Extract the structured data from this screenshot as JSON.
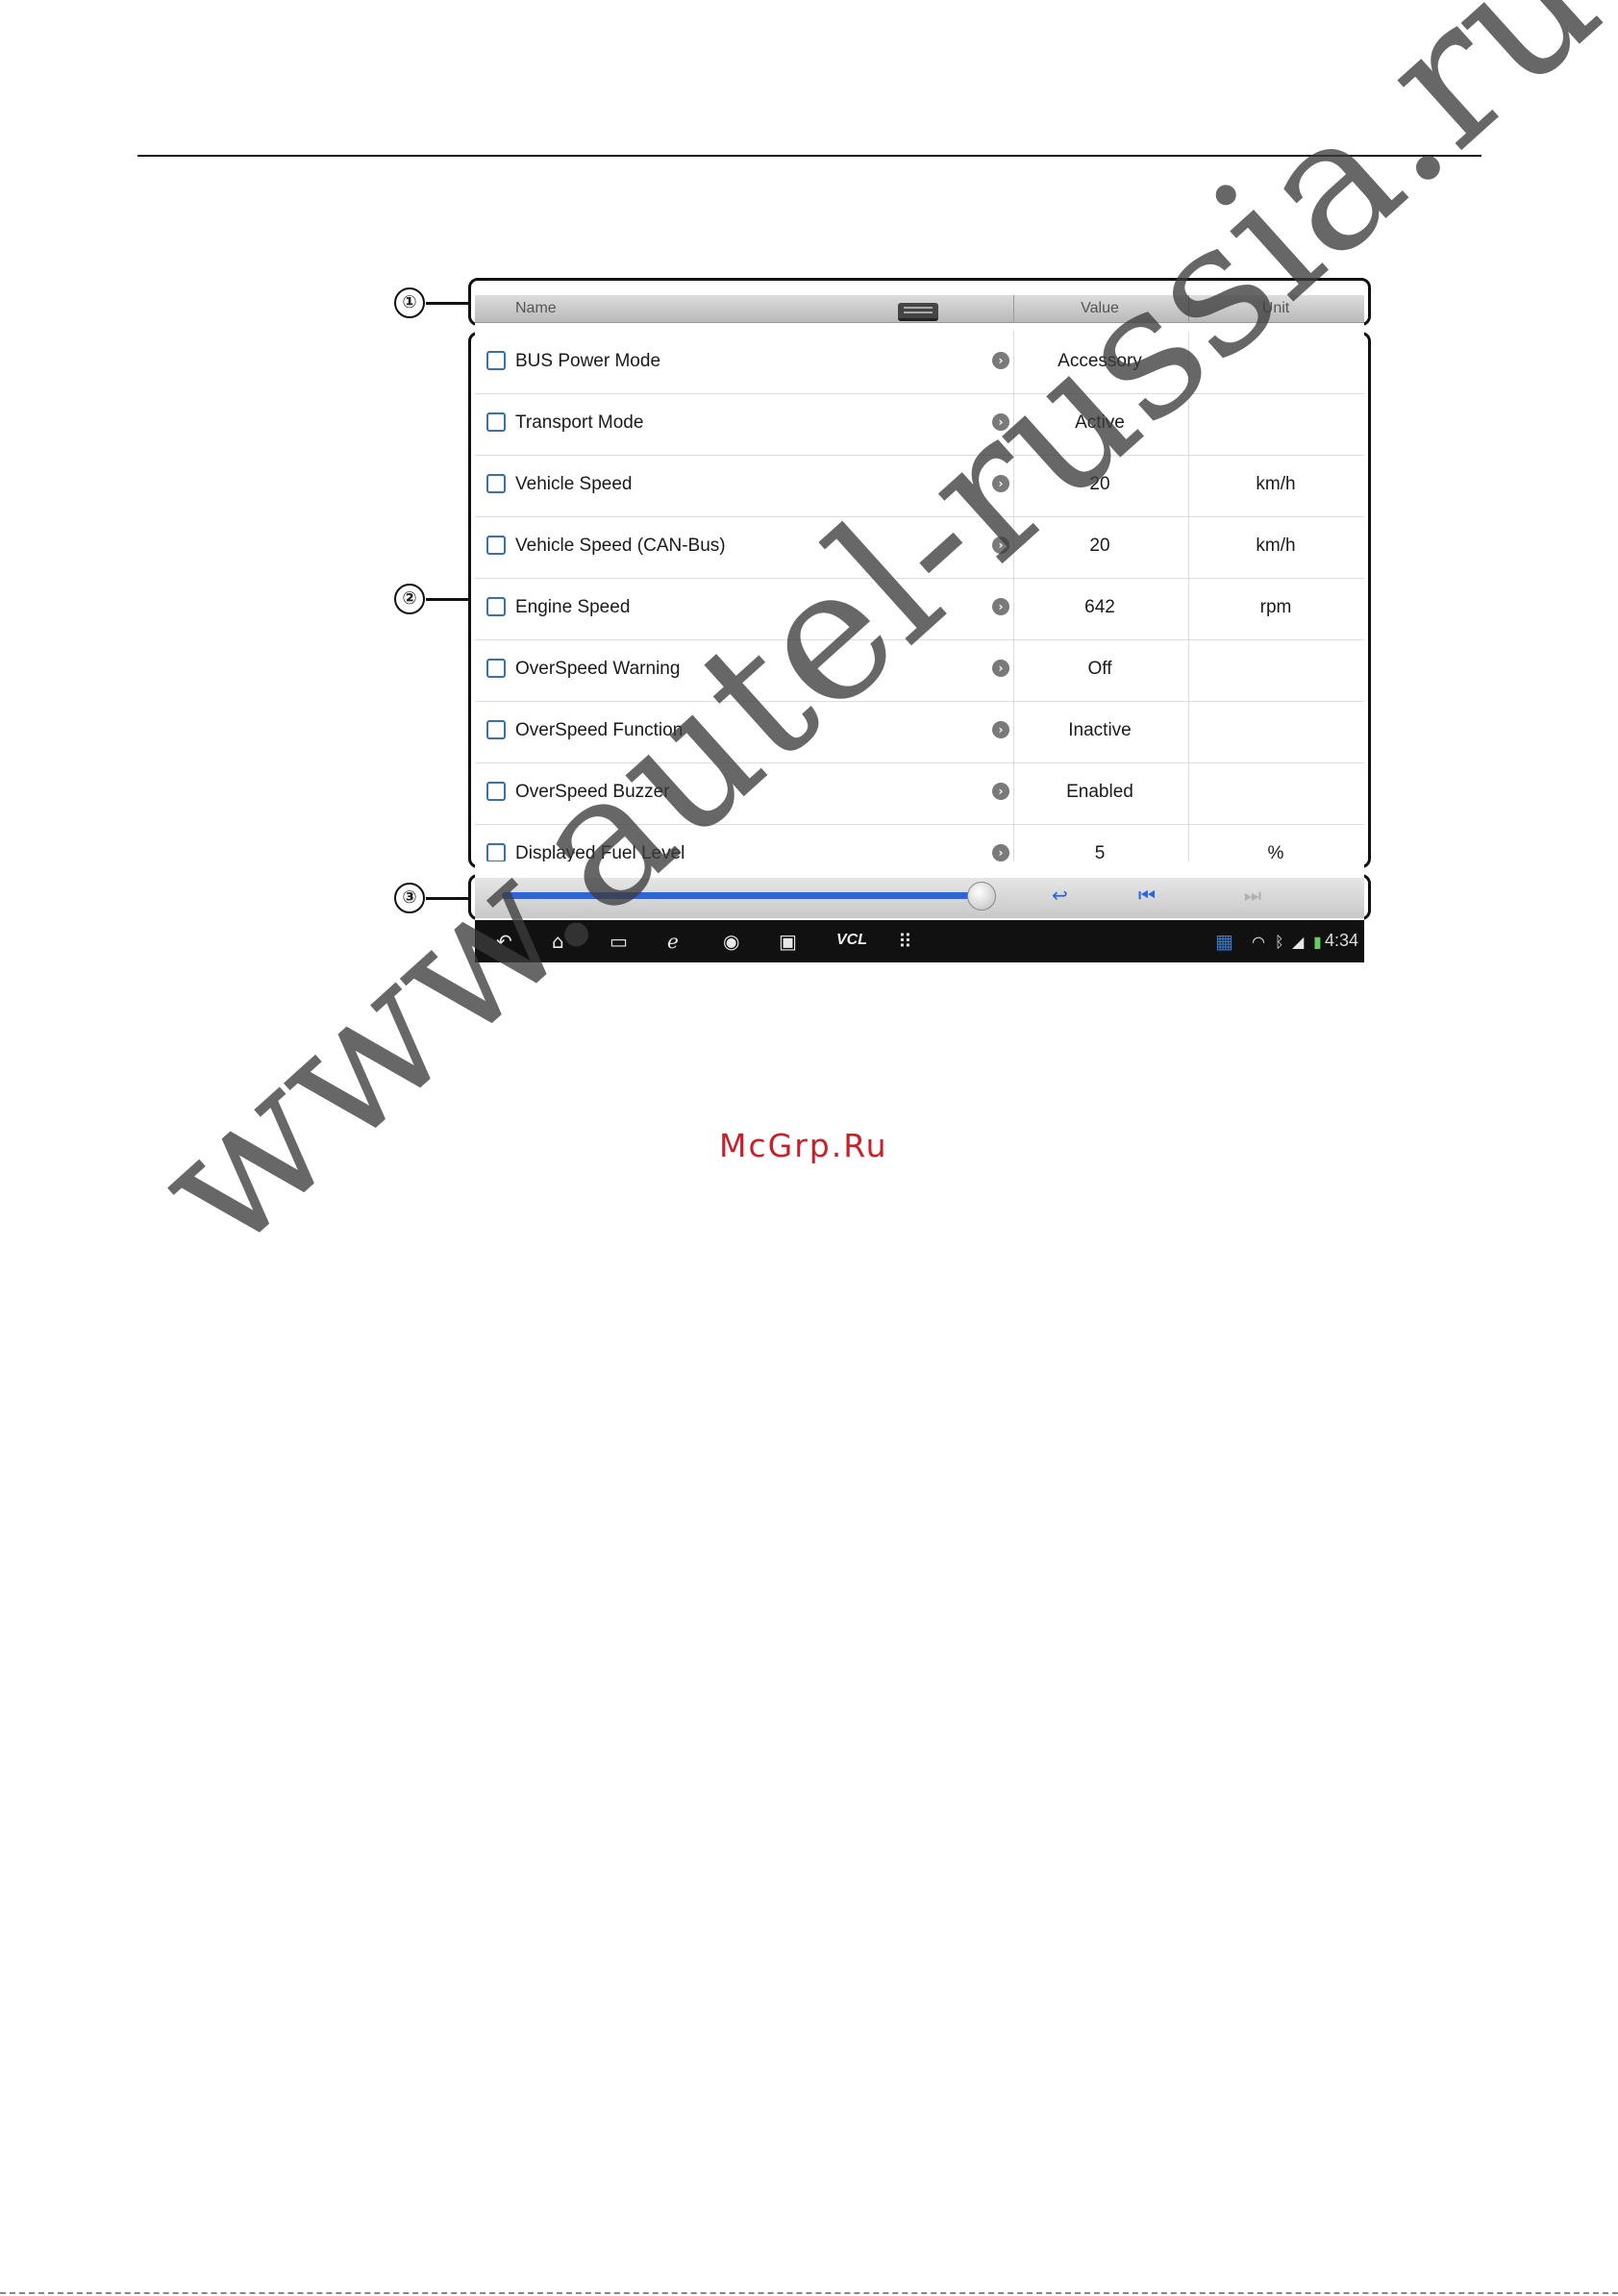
{
  "callouts": [
    "①",
    "②",
    "③"
  ],
  "table": {
    "headers": {
      "name": "Name",
      "value": "Value",
      "unit": "Unit"
    },
    "rows": [
      {
        "name": "BUS Power Mode",
        "value": "Accessory",
        "unit": ""
      },
      {
        "name": "Transport Mode",
        "value": "Active",
        "unit": ""
      },
      {
        "name": "Vehicle Speed",
        "value": "20",
        "unit": "km/h"
      },
      {
        "name": "Vehicle Speed (CAN-Bus)",
        "value": "20",
        "unit": "km/h"
      },
      {
        "name": "Engine Speed",
        "value": "642",
        "unit": "rpm"
      },
      {
        "name": "OverSpeed Warning",
        "value": "Off",
        "unit": ""
      },
      {
        "name": "OverSpeed Function",
        "value": "Inactive",
        "unit": ""
      },
      {
        "name": "OverSpeed Buzzer",
        "value": "Enabled",
        "unit": ""
      },
      {
        "name": "Displayed Fuel Level",
        "value": "5",
        "unit": "%"
      }
    ]
  },
  "playback": {
    "progress": 0.97
  },
  "navbar": {
    "icons": [
      "back-icon",
      "home-icon",
      "recent-apps-icon",
      "browser-icon",
      "camera-icon",
      "display-icon",
      "vcl-icon",
      "apps-grid-icon"
    ],
    "vcl_label": "VCL",
    "clock": "4:34"
  },
  "mcgrp_label": "McGrp.Ru",
  "watermark_text": "www.autel-russia.ru"
}
